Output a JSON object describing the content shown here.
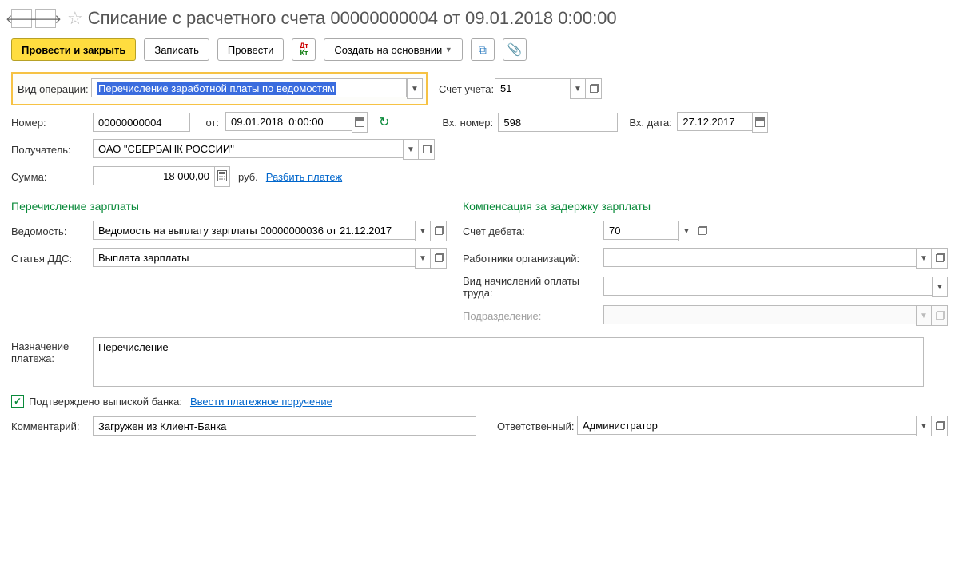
{
  "header": {
    "title": "Списание с расчетного счета 00000000004 от 09.01.2018 0:00:00"
  },
  "toolbar": {
    "post_close": "Провести и закрыть",
    "save": "Записать",
    "post": "Провести",
    "create_based": "Создать на основании"
  },
  "labels": {
    "operation_type": "Вид операции:",
    "account": "Счет учета:",
    "number": "Номер:",
    "from": "от:",
    "in_number": "Вх. номер:",
    "in_date": "Вх. дата:",
    "recipient": "Получатель:",
    "amount": "Сумма:",
    "currency": "руб.",
    "split_payment": "Разбить платеж",
    "section_salary": "Перечисление зарплаты",
    "section_compensation": "Компенсация за задержку зарплаты",
    "vedomost": "Ведомость:",
    "dds": "Статья ДДС:",
    "debit_account": "Счет дебета:",
    "org_employees": "Работники организаций:",
    "accrual_type": "Вид начислений оплаты труда:",
    "department": "Подразделение:",
    "purpose": "Назначение платежа:",
    "confirmed": "Подтверждено выпиской банка:",
    "enter_payment_order": "Ввести платежное поручение",
    "comment": "Комментарий:",
    "responsible": "Ответственный:"
  },
  "values": {
    "operation_type": "Перечисление заработной платы по ведомостям",
    "account": "51",
    "number": "00000000004",
    "date": "09.01.2018  0:00:00",
    "in_number": "598",
    "in_date": "27.12.2017",
    "recipient": "ОАО \"СБЕРБАНК РОССИИ\"",
    "amount": "18 000,00",
    "vedomost": "Ведомость на выплату зарплаты 00000000036 от 21.12.2017",
    "dds": "Выплата зарплаты",
    "debit_account": "70",
    "org_employees": "",
    "accrual_type": "",
    "department": "",
    "purpose": "Перечисление",
    "comment": "Загружен из Клиент-Банка",
    "responsible": "Администратор"
  }
}
